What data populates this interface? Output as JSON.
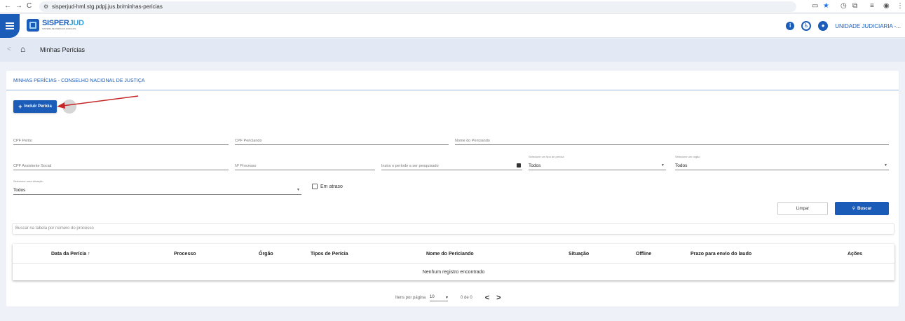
{
  "browser": {
    "back": "←",
    "forward": "→",
    "reload": "C",
    "url": "sisperjud-hml.stg.pdpj.jus.br/minhas-pericias"
  },
  "header": {
    "logo_title_a": "SISPER",
    "logo_title_b": "JUD",
    "logo_subtitle": "SISTEMA DE PERÍCIAS JUDICIAIS",
    "unit_label": "UNIDADE JUDICIARIA -..."
  },
  "breadcrumb": {
    "back": "<",
    "current": "Minhas Perícias"
  },
  "main": {
    "section_title": "MINHAS PERÍCIAS - CONSELHO NACIONAL DE JUSTIÇA",
    "add_button": "Incluir Perícia"
  },
  "filters": {
    "cpf_perito": "CPF Perito",
    "cpf_periciando": "CPF Periciando",
    "nome_periciando": "Nome do Periciando",
    "cpf_assistente": "CPF Assistente Social",
    "num_processo": "Nº Processo",
    "periodo": "Insira o período a ser pesquisado",
    "tipo_pericia_caption": "Selecione um tipo de perícia",
    "tipo_pericia_value": "Todos",
    "orgao_caption": "Selecione um órgão",
    "orgao_value": "Todos",
    "situacao_caption": "Selecione uma situação",
    "situacao_value": "Todos",
    "em_atraso": "Em atraso",
    "limpar": "Limpar",
    "buscar": "Buscar"
  },
  "table": {
    "search_placeholder": "Buscar na tabela por número do processo",
    "columns": [
      "Data da Perícia ↑",
      "Processo",
      "Órgão",
      "Tipos de Perícia",
      "Nome do Periciando",
      "Situação",
      "Offline",
      "Prazo para envio do laudo",
      "Ações"
    ],
    "empty_message": "Nenhum registro encontrado"
  },
  "pagination": {
    "items_per_page_label": "Itens por página",
    "items_per_page": "10",
    "range": "0 de 0",
    "prev": "<",
    "next": ">"
  },
  "colors": {
    "primary": "#1b5cb8",
    "annotation_arrow": "#c62828"
  }
}
